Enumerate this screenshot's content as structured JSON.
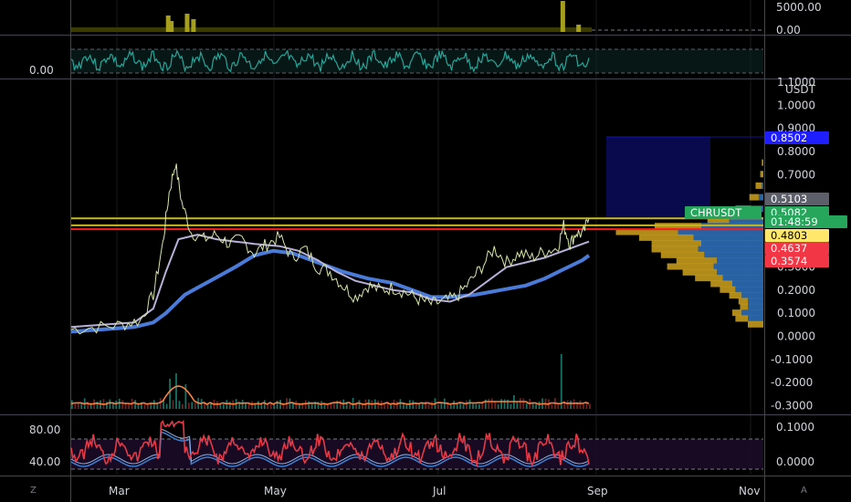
{
  "chart_data": {
    "type": "line",
    "symbol": "CHRUSDT",
    "currency": "USDT",
    "x_axis_labels": [
      "Mar",
      "May",
      "Jul",
      "Sep",
      "Nov"
    ],
    "price_axis": {
      "ticks": [
        "1.1000",
        "1.0000",
        "0.9000",
        "0.8000",
        "0.7000",
        "0.6000",
        "0.5000",
        "0.4000",
        "0.3000",
        "0.2000",
        "0.1000",
        "0.0000",
        "-0.1000",
        "-0.2000",
        "-0.3000"
      ],
      "ylim": [
        -0.33,
        1.1
      ]
    },
    "volume_pane_ticks": [
      "5000.00",
      "0.00"
    ],
    "osc_pane_ticks": [
      "0.00"
    ],
    "rsi_pane": {
      "ticks_left": [
        "80.00",
        "40.00"
      ],
      "ticks_right": [
        "0.1000",
        "0.0000"
      ]
    },
    "price_badges": [
      {
        "label": "0.8502",
        "color": "#1e1eff",
        "text_color": "#ffffff",
        "value": 0.8502
      },
      {
        "label": "0.5103",
        "color": "#5d606b",
        "text_color": "#ffffff",
        "value": 0.5103
      },
      {
        "label": "CHRUSDT",
        "color": "#26a65b",
        "text_color": "#ffffff",
        "value": 0.5082
      },
      {
        "label": "0.5082",
        "color": "#26a65b",
        "text_color": "#ffffff",
        "value": 0.5082
      },
      {
        "label": "01:48:59",
        "color": "#26a65b",
        "text_color": "#ffffff",
        "value": 0.5082
      },
      {
        "label": "0.4803",
        "color": "#ffe76b",
        "text_color": "#000000",
        "value": 0.4803
      },
      {
        "label": "0.4637",
        "color": "#f23645",
        "text_color": "#ffffff",
        "value": 0.4637
      },
      {
        "label": "0.3574",
        "color": "#f23645",
        "text_color": "#ffffff",
        "value": 0.3574
      }
    ],
    "horizontal_lines": [
      {
        "value": 0.5103,
        "color": "#c9b81f"
      },
      {
        "value": 0.4803,
        "color": "#c9b81f"
      },
      {
        "value": 0.4637,
        "color": "#ff1a1a"
      }
    ],
    "price_series": [
      [
        0,
        0.03
      ],
      [
        8,
        0.04
      ],
      [
        16,
        0.05
      ],
      [
        22,
        0.07
      ],
      [
        26,
        0.18
      ],
      [
        29,
        0.4
      ],
      [
        31,
        0.62
      ],
      [
        33,
        0.75
      ],
      [
        35,
        0.58
      ],
      [
        38,
        0.45
      ],
      [
        42,
        0.42
      ],
      [
        46,
        0.44
      ],
      [
        50,
        0.4
      ],
      [
        54,
        0.42
      ],
      [
        58,
        0.36
      ],
      [
        62,
        0.4
      ],
      [
        66,
        0.43
      ],
      [
        70,
        0.34
      ],
      [
        74,
        0.38
      ],
      [
        78,
        0.3
      ],
      [
        82,
        0.28
      ],
      [
        86,
        0.22
      ],
      [
        90,
        0.17
      ],
      [
        94,
        0.22
      ],
      [
        98,
        0.2
      ],
      [
        102,
        0.21
      ],
      [
        106,
        0.19
      ],
      [
        110,
        0.16
      ],
      [
        114,
        0.14
      ],
      [
        118,
        0.15
      ],
      [
        122,
        0.17
      ],
      [
        126,
        0.23
      ],
      [
        130,
        0.3
      ],
      [
        134,
        0.38
      ],
      [
        138,
        0.32
      ],
      [
        142,
        0.36
      ],
      [
        146,
        0.34
      ],
      [
        150,
        0.37
      ],
      [
        154,
        0.38
      ],
      [
        156,
        0.48
      ],
      [
        158,
        0.4
      ],
      [
        160,
        0.45
      ],
      [
        162,
        0.44
      ],
      [
        164,
        0.51
      ]
    ],
    "ma_fast": [
      [
        0,
        0.04
      ],
      [
        20,
        0.06
      ],
      [
        26,
        0.12
      ],
      [
        30,
        0.28
      ],
      [
        34,
        0.42
      ],
      [
        40,
        0.44
      ],
      [
        46,
        0.42
      ],
      [
        52,
        0.41
      ],
      [
        58,
        0.4
      ],
      [
        66,
        0.39
      ],
      [
        72,
        0.37
      ],
      [
        78,
        0.33
      ],
      [
        84,
        0.28
      ],
      [
        90,
        0.24
      ],
      [
        96,
        0.22
      ],
      [
        102,
        0.2
      ],
      [
        108,
        0.19
      ],
      [
        114,
        0.16
      ],
      [
        120,
        0.15
      ],
      [
        126,
        0.18
      ],
      [
        132,
        0.24
      ],
      [
        138,
        0.3
      ],
      [
        144,
        0.32
      ],
      [
        150,
        0.34
      ],
      [
        156,
        0.37
      ],
      [
        162,
        0.4
      ],
      [
        164,
        0.41
      ]
    ],
    "ma_slow": [
      [
        0,
        0.02
      ],
      [
        20,
        0.04
      ],
      [
        26,
        0.06
      ],
      [
        30,
        0.1
      ],
      [
        36,
        0.18
      ],
      [
        44,
        0.24
      ],
      [
        52,
        0.3
      ],
      [
        58,
        0.35
      ],
      [
        64,
        0.37
      ],
      [
        70,
        0.36
      ],
      [
        78,
        0.32
      ],
      [
        86,
        0.28
      ],
      [
        94,
        0.25
      ],
      [
        102,
        0.23
      ],
      [
        108,
        0.2
      ],
      [
        114,
        0.17
      ],
      [
        120,
        0.17
      ],
      [
        128,
        0.18
      ],
      [
        136,
        0.2
      ],
      [
        144,
        0.22
      ],
      [
        150,
        0.25
      ],
      [
        156,
        0.29
      ],
      [
        162,
        0.33
      ],
      [
        164,
        0.35
      ]
    ],
    "volume_profile": [
      {
        "price": 0.75,
        "up": 0.01,
        "down": 0.0
      },
      {
        "price": 0.7,
        "up": 0.02,
        "down": 0.0
      },
      {
        "price": 0.65,
        "up": 0.04,
        "down": 0.01
      },
      {
        "price": 0.6,
        "up": 0.06,
        "down": 0.03
      },
      {
        "price": 0.55,
        "up": 0.1,
        "down": 0.08
      },
      {
        "price": 0.5,
        "up": 0.14,
        "down": 0.22
      },
      {
        "price": 0.475,
        "up": 0.3,
        "down": 0.4
      },
      {
        "price": 0.45,
        "up": 0.4,
        "down": 0.55
      },
      {
        "price": 0.425,
        "up": 0.35,
        "down": 0.45
      },
      {
        "price": 0.4,
        "up": 0.32,
        "down": 0.4
      },
      {
        "price": 0.375,
        "up": 0.3,
        "down": 0.42
      },
      {
        "price": 0.35,
        "up": 0.28,
        "down": 0.38
      },
      {
        "price": 0.325,
        "up": 0.26,
        "down": 0.3
      },
      {
        "price": 0.3,
        "up": 0.3,
        "down": 0.32
      },
      {
        "price": 0.275,
        "up": 0.22,
        "down": 0.3
      },
      {
        "price": 0.25,
        "up": 0.18,
        "down": 0.26
      },
      {
        "price": 0.225,
        "up": 0.14,
        "down": 0.2
      },
      {
        "price": 0.2,
        "up": 0.1,
        "down": 0.18
      },
      {
        "price": 0.175,
        "up": 0.08,
        "down": 0.14
      },
      {
        "price": 0.15,
        "up": 0.06,
        "down": 0.1
      },
      {
        "price": 0.125,
        "up": 0.05,
        "down": 0.1
      },
      {
        "price": 0.1,
        "up": 0.06,
        "down": 0.14
      },
      {
        "price": 0.075,
        "up": 0.08,
        "down": 0.1
      },
      {
        "price": 0.05,
        "up": 0.1,
        "down": 0.0
      }
    ],
    "volume_spikes": [
      {
        "t": 24,
        "v": 0.08
      },
      {
        "t": 31,
        "v": 0.55
      },
      {
        "t": 33,
        "v": 0.65
      },
      {
        "t": 36,
        "v": 0.45
      },
      {
        "t": 40,
        "v": 0.2
      },
      {
        "t": 90,
        "v": 0.12
      },
      {
        "t": 120,
        "v": 0.1
      },
      {
        "t": 136,
        "v": 0.18
      },
      {
        "t": 140,
        "v": 0.25
      },
      {
        "t": 155,
        "v": 1.0
      },
      {
        "t": 160,
        "v": 0.12
      }
    ]
  },
  "ui": {
    "corner_left": "Z",
    "corner_right": "A"
  }
}
